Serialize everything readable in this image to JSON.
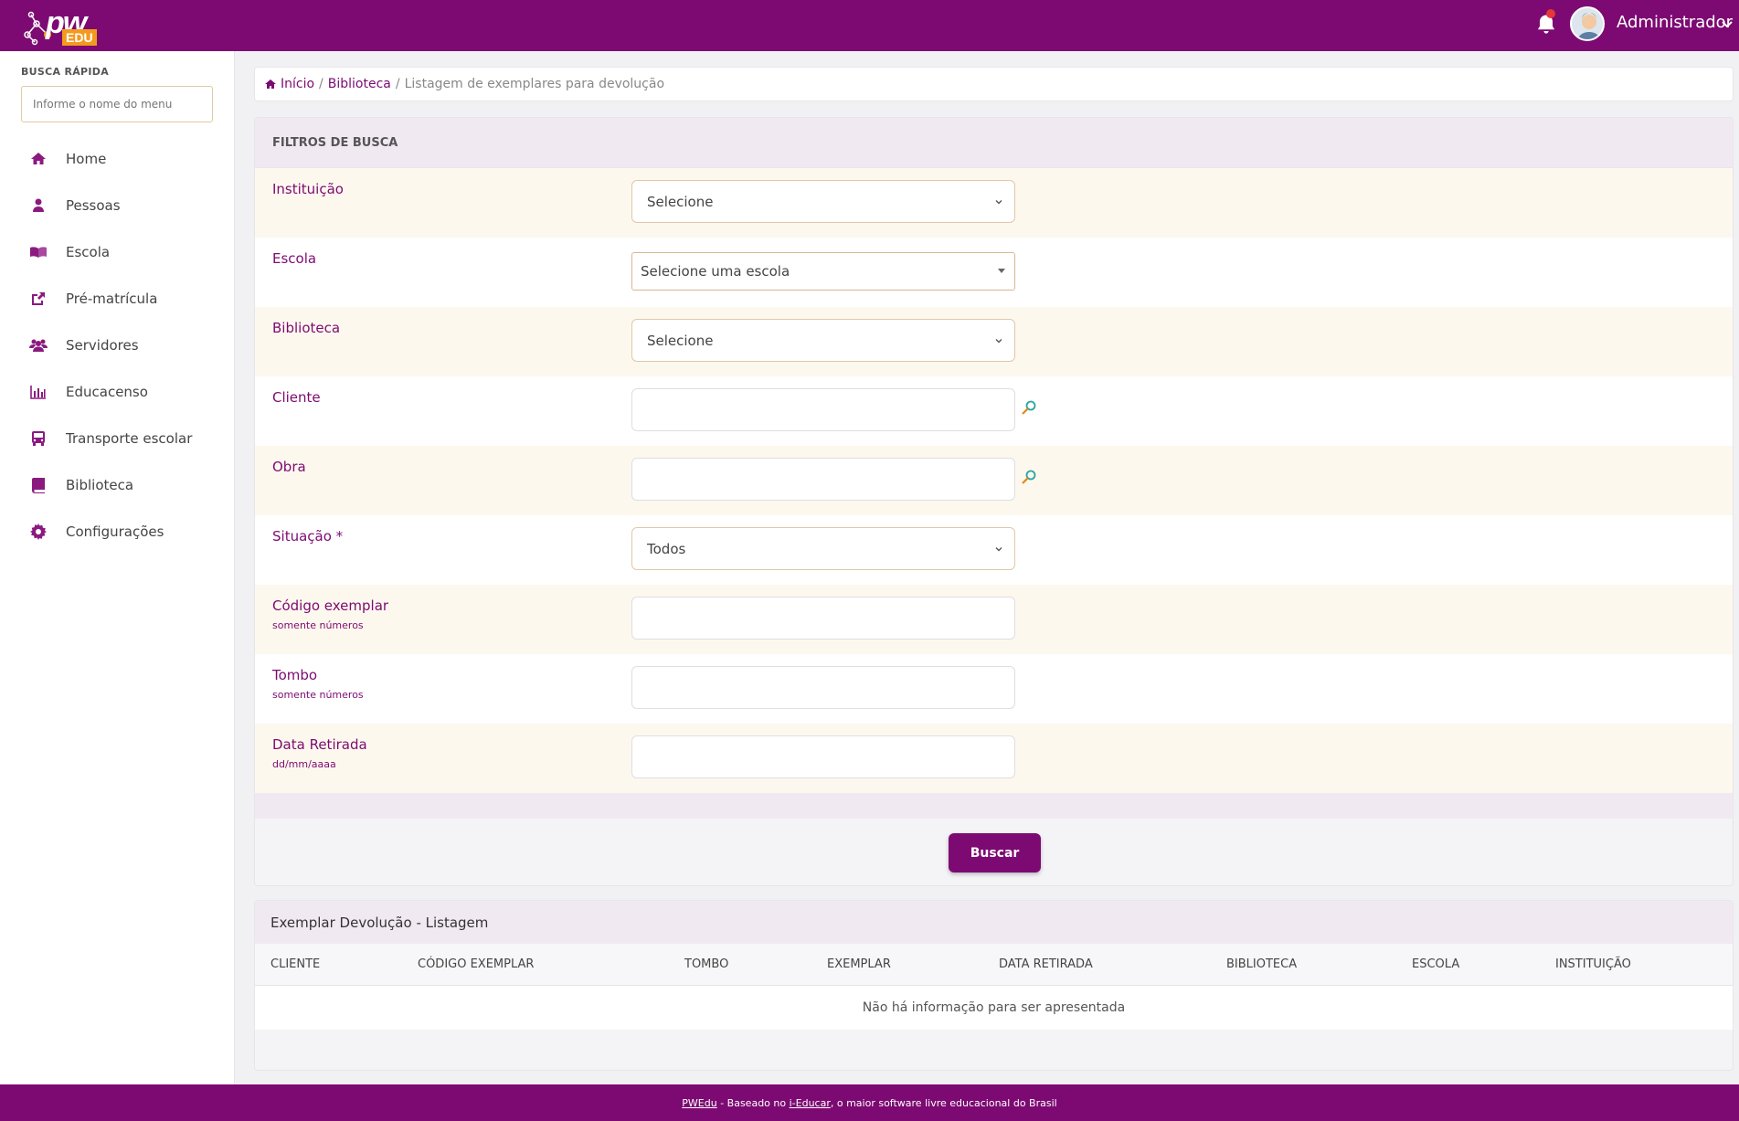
{
  "header": {
    "logo_pw": "pw",
    "logo_edu": "EDU",
    "user_name": "Administrador"
  },
  "sidebar": {
    "quick_search_label": "BUSCA RÁPIDA",
    "quick_search_placeholder": "Informe o nome do menu",
    "items": [
      {
        "label": "Home",
        "icon": "home-icon"
      },
      {
        "label": "Pessoas",
        "icon": "user-icon"
      },
      {
        "label": "Escola",
        "icon": "book-open-icon"
      },
      {
        "label": "Pré-matrícula",
        "icon": "share-icon"
      },
      {
        "label": "Servidores",
        "icon": "users-icon"
      },
      {
        "label": "Educacenso",
        "icon": "bar-chart-icon"
      },
      {
        "label": "Transporte escolar",
        "icon": "bus-icon"
      },
      {
        "label": "Biblioteca",
        "icon": "book-icon"
      },
      {
        "label": "Configurações",
        "icon": "gear-icon"
      }
    ]
  },
  "breadcrumb": {
    "home": "Início",
    "section": "Biblioteca",
    "current": "Listagem de exemplares para devolução",
    "separator": "/"
  },
  "filters": {
    "title": "FILTROS DE BUSCA",
    "instituicao": {
      "label": "Instituição",
      "value": "Selecione"
    },
    "escola": {
      "label": "Escola",
      "value": "Selecione uma escola"
    },
    "biblioteca": {
      "label": "Biblioteca",
      "value": "Selecione"
    },
    "cliente": {
      "label": "Cliente",
      "value": ""
    },
    "obra": {
      "label": "Obra",
      "value": ""
    },
    "situacao": {
      "label": "Situação *",
      "value": "Todos"
    },
    "codigo_exemplar": {
      "label": "Código exemplar",
      "hint": "somente números",
      "value": ""
    },
    "tombo": {
      "label": "Tombo",
      "hint": "somente números",
      "value": ""
    },
    "data_retirada": {
      "label": "Data Retirada",
      "hint": "dd/mm/aaaa",
      "value": ""
    },
    "search_button": "Buscar"
  },
  "listing": {
    "title": "Exemplar Devolução - Listagem",
    "columns": [
      "CLIENTE",
      "CÓDIGO EXEMPLAR",
      "TOMBO",
      "EXEMPLAR",
      "DATA RETIRADA",
      "BIBLIOTECA",
      "ESCOLA",
      "INSTITUIÇÃO"
    ],
    "empty_message": "Não há informação para ser apresentada"
  },
  "footer": {
    "brand_link": "PWEdu",
    "text_1": " - Baseado no ",
    "ieducar_link": "i-Educar",
    "text_2": ", o maior software livre educacional do Brasil"
  },
  "colors": {
    "primary": "#7d0a72",
    "accent": "#f39a1e"
  }
}
